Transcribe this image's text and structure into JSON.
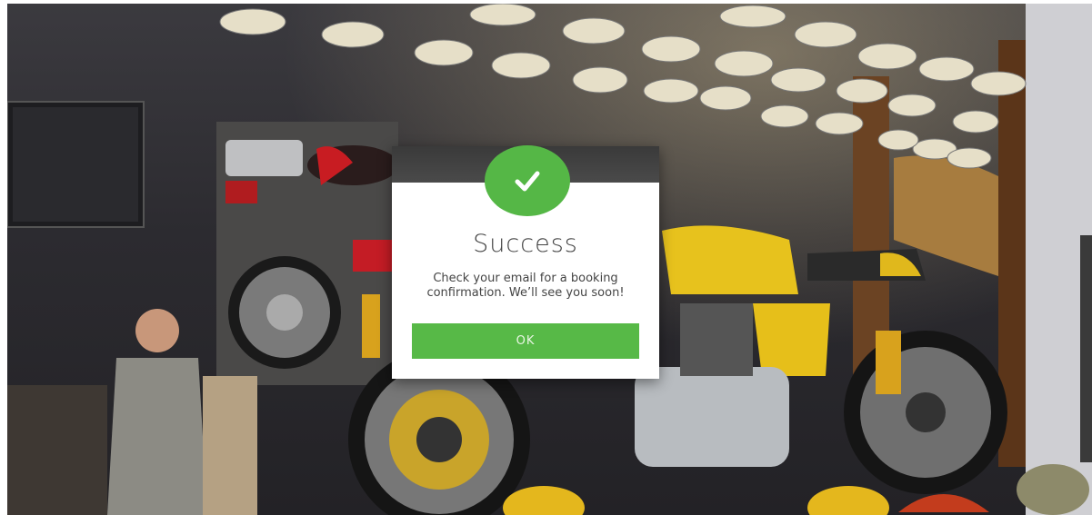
{
  "background": {
    "description_icon": "motorcycle-showroom-image"
  },
  "modal": {
    "icon": "check-icon",
    "title": "Success",
    "message": "Check your email for a booking confirmation. We’ll see you soon!",
    "ok_label": "OK",
    "accent_color": "#57b947"
  }
}
